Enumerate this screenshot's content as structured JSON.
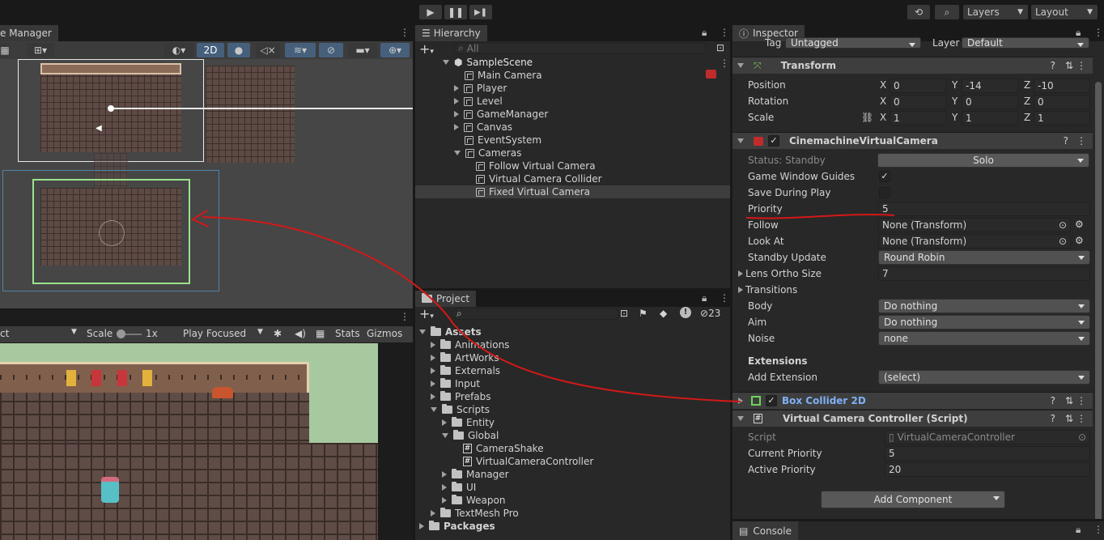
{
  "toolbar": {
    "layers_label": "Layers",
    "layout_label": "Layout"
  },
  "scene": {
    "tab_label": "e Manager",
    "mode_2d": "2D"
  },
  "game": {
    "display_label": "ct",
    "scale_label": "Scale",
    "scale_value": "1x",
    "play_mode": "Play Focused",
    "stats_label": "Stats",
    "gizmos_label": "Gizmos"
  },
  "hierarchy": {
    "tab_label": "Hierarchy",
    "search_placeholder": "All",
    "scene_name": "SampleScene",
    "items": [
      {
        "label": "Main Camera"
      },
      {
        "label": "Player"
      },
      {
        "label": "Level"
      },
      {
        "label": "GameManager"
      },
      {
        "label": "Canvas"
      },
      {
        "label": "EventSystem"
      },
      {
        "label": "Cameras"
      },
      {
        "label": "Follow Virtual Camera"
      },
      {
        "label": "Virtual Camera Collider"
      },
      {
        "label": "Fixed Virtual Camera"
      }
    ]
  },
  "project": {
    "tab_label": "Project",
    "hidden_count": "23",
    "items": [
      {
        "label": "Assets"
      },
      {
        "label": "Animations"
      },
      {
        "label": "ArtWorks"
      },
      {
        "label": "Externals"
      },
      {
        "label": "Input"
      },
      {
        "label": "Prefabs"
      },
      {
        "label": "Scripts"
      },
      {
        "label": "Entity"
      },
      {
        "label": "Global"
      },
      {
        "label": "CameraShake"
      },
      {
        "label": "VirtualCameraController"
      },
      {
        "label": "Manager"
      },
      {
        "label": "UI"
      },
      {
        "label": "Weapon"
      },
      {
        "label": "TextMesh Pro"
      },
      {
        "label": "Packages"
      }
    ]
  },
  "inspector": {
    "tab_label": "Inspector",
    "tag_label": "Tag",
    "tag_value": "Untagged",
    "layer_label": "Layer",
    "layer_value": "Default",
    "transform": {
      "title": "Transform",
      "position_label": "Position",
      "rotation_label": "Rotation",
      "scale_label": "Scale",
      "x": "X",
      "y": "Y",
      "z": "Z",
      "position": [
        "0",
        "-14",
        "-10"
      ],
      "rotation": [
        "0",
        "0",
        "0"
      ],
      "scale": [
        "1",
        "1",
        "1"
      ]
    },
    "vcam": {
      "title": "CinemachineVirtualCamera",
      "status": "Status: Standby",
      "solo_label": "Solo",
      "game_window_guides_label": "Game Window Guides",
      "save_during_play_label": "Save During Play",
      "priority_label": "Priority",
      "priority_value": "5",
      "follow_label": "Follow",
      "follow_value": "None (Transform)",
      "look_at_label": "Look At",
      "look_at_value": "None (Transform)",
      "standby_update_label": "Standby Update",
      "standby_update_value": "Round Robin",
      "lens_label": "Lens Ortho Size",
      "lens_value": "7",
      "transitions_label": "Transitions",
      "body_label": "Body",
      "body_value": "Do nothing",
      "aim_label": "Aim",
      "aim_value": "Do nothing",
      "noise_label": "Noise",
      "noise_value": "none",
      "extensions_label": "Extensions",
      "add_extension_label": "Add Extension",
      "add_extension_value": "(select)"
    },
    "box_collider": {
      "title": "Box Collider 2D"
    },
    "vcc": {
      "title": "Virtual Camera Controller (Script)",
      "script_label": "Script",
      "script_value": "VirtualCameraController",
      "current_priority_label": "Current Priority",
      "current_priority_value": "5",
      "active_priority_label": "Active Priority",
      "active_priority_value": "20"
    },
    "add_component_label": "Add Component"
  },
  "console": {
    "tab_label": "Console"
  },
  "colors": {
    "annotation": "#d41818",
    "selection_green": "#9be28c",
    "link_blue": "#7fb0f5"
  }
}
